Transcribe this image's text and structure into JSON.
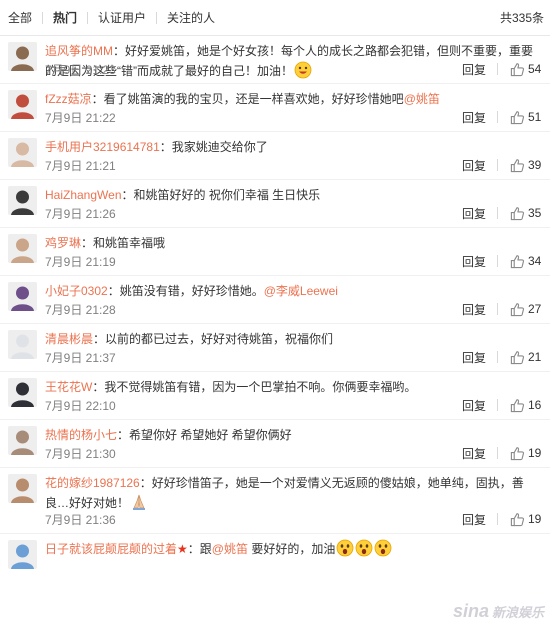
{
  "tabs": [
    {
      "label": "全部",
      "active": false
    },
    {
      "label": "热门",
      "active": true
    },
    {
      "label": "认证用户",
      "active": false
    },
    {
      "label": "关注的人",
      "active": false
    }
  ],
  "total": "共335条",
  "reply_label": "回复",
  "watermark": {
    "brand": "sina",
    "text": "新浪娱乐"
  },
  "colors": {
    "username": "#eb7350",
    "meta": "#808080",
    "emphasis_star": "#e8331d"
  },
  "comments": [
    {
      "user": "追风筝的MM",
      "text": "：好好爱姚笛，她是个好女孩！每个人的成长之路都会犯错，但则不重要，重要的是因为这些“错”而成就了最好的自己！加油！",
      "emoji": [
        "grin-emoji"
      ],
      "time": "7月9日 21:23",
      "likes": "54",
      "avatar_color": "#8b6a52"
    },
    {
      "user": "fZzz菇凉",
      "text": "：看了姚笛演的我的宝贝，还是一样喜欢她，好好珍惜她吧",
      "mention": "@姚笛",
      "time": "7月9日 21:22",
      "likes": "51",
      "avatar_color": "#c14d3f"
    },
    {
      "user": "手机用户3219614781",
      "text": "：我家姚迪交给你了",
      "time": "7月9日 21:21",
      "likes": "39",
      "avatar_color": "#d7b9a4"
    },
    {
      "user": "HaiZhangWen",
      "text": "：和姚笛好好的 祝你们幸福 生日快乐",
      "time": "7月9日 21:26",
      "likes": "35",
      "avatar_color": "#3b3b3b"
    },
    {
      "user": "鸡罗琳",
      "text": "：和姚笛幸福哦",
      "time": "7月9日 21:19",
      "likes": "34",
      "avatar_color": "#caa58a"
    },
    {
      "user": "小妃子0302",
      "text": "：姚笛没有错，好好珍惜她。",
      "mention": "@李威Leewei",
      "time": "7月9日 21:28",
      "likes": "27",
      "avatar_color": "#6e4f8a"
    },
    {
      "user": "清晨彬晨",
      "text": "：以前的都已过去，好好对待姚笛，祝福你们",
      "time": "7月9日 21:37",
      "likes": "21",
      "avatar_color": "#dfe3e8"
    },
    {
      "user": "王花花W",
      "text": "：我不觉得姚笛有错，因为一个巴掌拍不响。你俩要幸福哟。",
      "time": "7月9日 22:10",
      "likes": "16",
      "avatar_color": "#2f2f38"
    },
    {
      "user": "热情的杨小七",
      "text": "：希望你好 希望她好 希望你俩好",
      "time": "7月9日 21:30",
      "likes": "19",
      "avatar_color": "#a88c7a"
    },
    {
      "user": "花的嫁纱1987126",
      "text": "：好好珍惜笛子，她是一个对爱情义无返顾的傻姑娘，她单纯，固执，善良…好好对她！",
      "emoji": [
        "pray-emoji"
      ],
      "time": "7月9日 21:36",
      "likes": "19",
      "avatar_color": "#b78d6e"
    },
    {
      "user": "日子就该屁颠屁颠的过着",
      "star": "★",
      "text_prefix": "：跟",
      "mention": "@姚笛",
      "text": " 要好好的，加油",
      "emoji": [
        "surprised-emoji",
        "surprised-emoji",
        "surprised-emoji"
      ],
      "time": "",
      "likes": "",
      "avatar_color": "#6b9fd6"
    }
  ]
}
